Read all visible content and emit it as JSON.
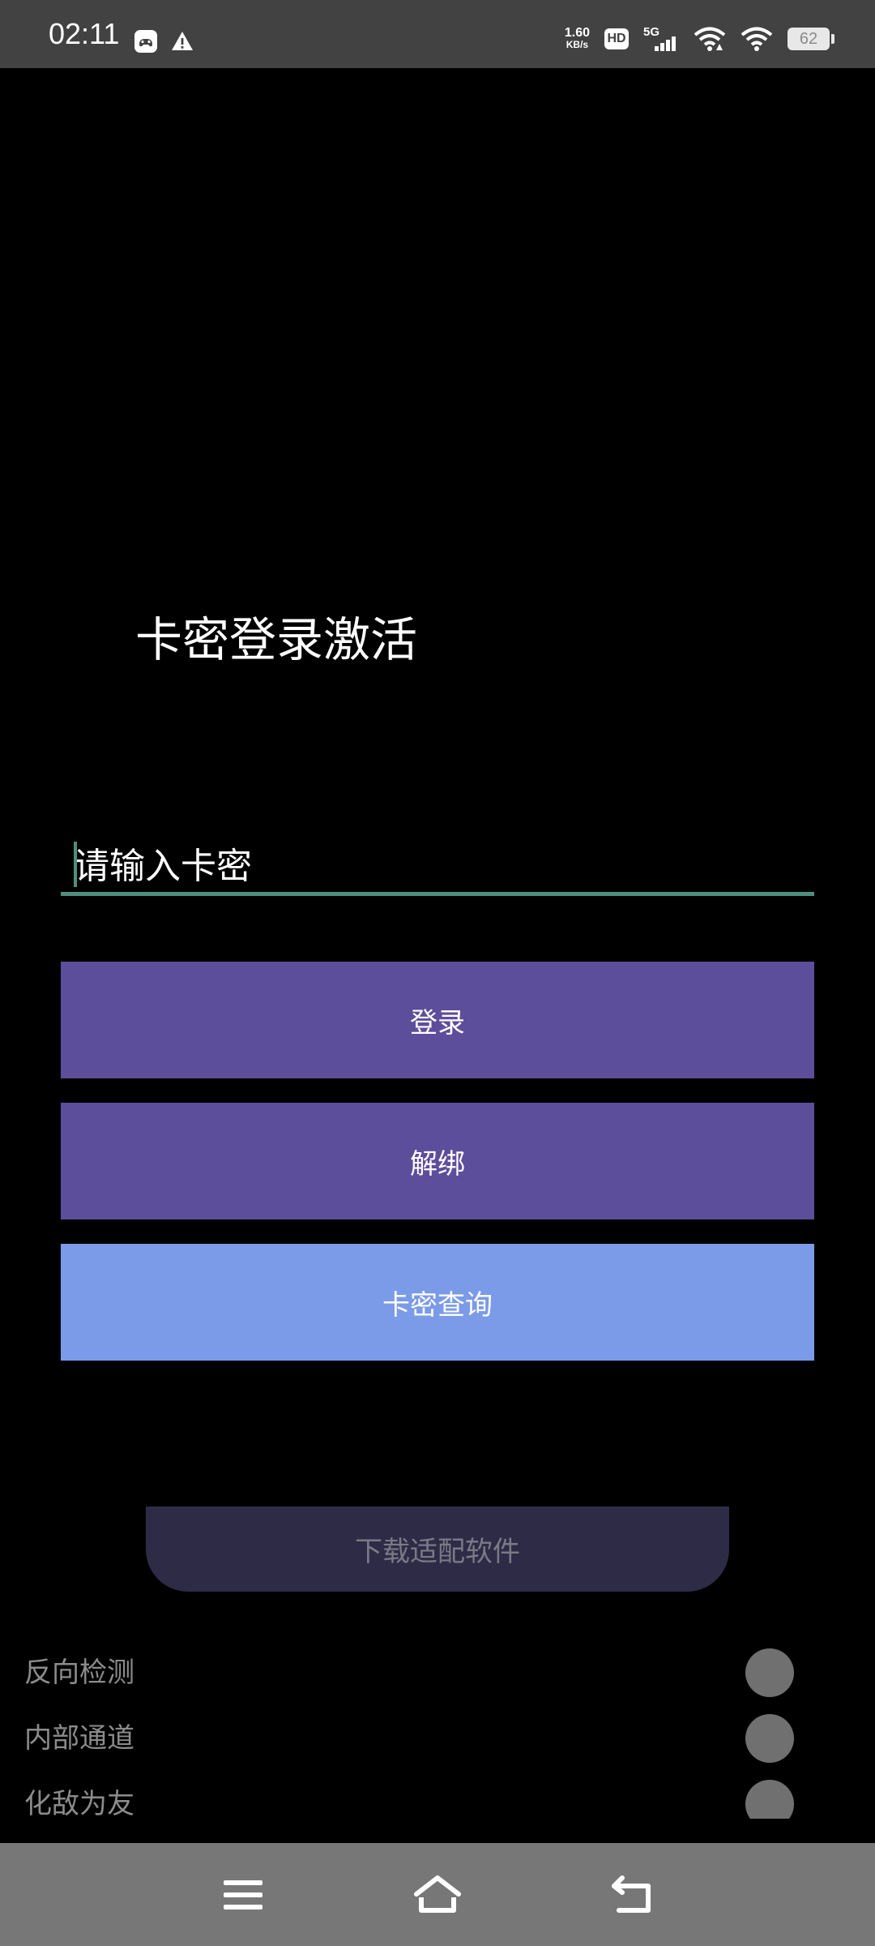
{
  "status_bar": {
    "time": "02:11",
    "net_speed_value": "1.60",
    "net_speed_unit": "KB/s",
    "hd_label": "HD",
    "network_type": "5G",
    "battery_level": "62"
  },
  "dialog": {
    "title": "卡密登录激活",
    "input_placeholder": "请输入卡密",
    "buttons": {
      "login": "登录",
      "unbind": "解绑",
      "query": "卡密查询"
    }
  },
  "background": {
    "download_label": "下载适配软件",
    "settings": [
      {
        "label": "反向检测"
      },
      {
        "label": "内部通道"
      },
      {
        "label": "化敌为友"
      }
    ]
  },
  "colors": {
    "accent_green": "#4e8f7d",
    "button_purple": "#5c4e9b",
    "button_blue": "#7b9be8"
  }
}
